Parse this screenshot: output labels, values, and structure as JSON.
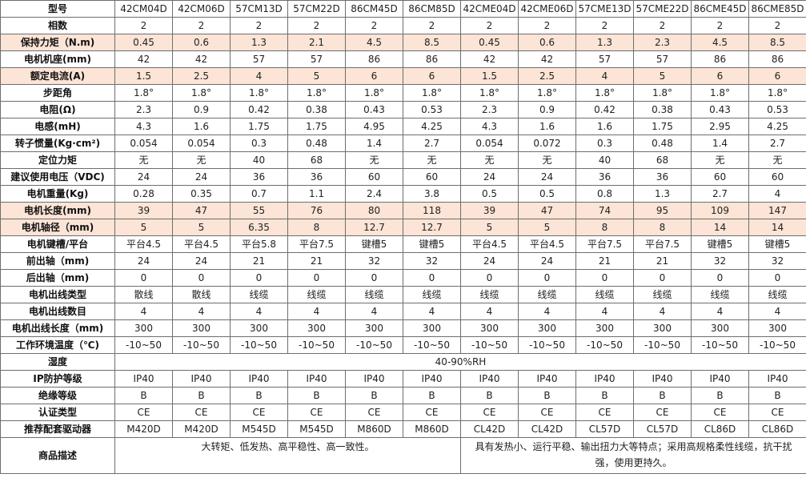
{
  "header": {
    "label": "型号",
    "models": [
      "42CM04D",
      "42CM06D",
      "57CM13D",
      "57CM22D",
      "86CM45D",
      "86CM85D",
      "42CME04D",
      "42CME06D",
      "57CME13D",
      "57CME22D",
      "86CME45D",
      "86CME85D"
    ]
  },
  "rows": [
    {
      "label": "相数",
      "highlight": false,
      "values": [
        "2",
        "2",
        "2",
        "2",
        "2",
        "2",
        "2",
        "2",
        "2",
        "2",
        "2",
        "2"
      ]
    },
    {
      "label": "保持力矩（N.m)",
      "highlight": true,
      "values": [
        "0.45",
        "0.6",
        "1.3",
        "2.1",
        "4.5",
        "8.5",
        "0.45",
        "0.6",
        "1.3",
        "2.3",
        "4.5",
        "8.5"
      ]
    },
    {
      "label": "电机机座(mm)",
      "highlight": false,
      "values": [
        "42",
        "42",
        "57",
        "57",
        "86",
        "86",
        "42",
        "42",
        "57",
        "57",
        "86",
        "86"
      ]
    },
    {
      "label": "额定电流(A)",
      "highlight": true,
      "values": [
        "1.5",
        "2.5",
        "4",
        "5",
        "6",
        "6",
        "1.5",
        "2.5",
        "4",
        "5",
        "6",
        "6"
      ]
    },
    {
      "label": "步距角",
      "highlight": false,
      "values": [
        "1.8°",
        "1.8°",
        "1.8°",
        "1.8°",
        "1.8°",
        "1.8°",
        "1.8°",
        "1.8°",
        "1.8°",
        "1.8°",
        "1.8°",
        "1.8°"
      ]
    },
    {
      "label": "电阻(Ω)",
      "highlight": false,
      "values": [
        "2.3",
        "0.9",
        "0.42",
        "0.38",
        "0.43",
        "0.53",
        "2.3",
        "0.9",
        "0.42",
        "0.38",
        "0.43",
        "0.53"
      ]
    },
    {
      "label": "电感(mH)",
      "highlight": false,
      "values": [
        "4.3",
        "1.6",
        "1.75",
        "1.75",
        "4.95",
        "4.25",
        "4.3",
        "1.6",
        "1.6",
        "1.75",
        "2.95",
        "4.25"
      ]
    },
    {
      "label": "转子惯量(Kg·cm²)",
      "highlight": false,
      "values": [
        "0.054",
        "0.054",
        "0.3",
        "0.48",
        "1.4",
        "2.7",
        "0.054",
        "0.072",
        "0.3",
        "0.48",
        "1.4",
        "2.7"
      ]
    },
    {
      "label": "定位力矩",
      "highlight": false,
      "values": [
        "无",
        "无",
        "40",
        "68",
        "无",
        "无",
        "无",
        "无",
        "40",
        "68",
        "无",
        "无"
      ]
    },
    {
      "label": "建议使用电压（VDC)",
      "highlight": false,
      "values": [
        "24",
        "24",
        "36",
        "36",
        "60",
        "60",
        "24",
        "24",
        "36",
        "36",
        "60",
        "60"
      ]
    },
    {
      "label": "电机重量(Kg)",
      "highlight": false,
      "values": [
        "0.28",
        "0.35",
        "0.7",
        "1.1",
        "2.4",
        "3.8",
        "0.5",
        "0.5",
        "0.8",
        "1.3",
        "2.7",
        "4"
      ]
    },
    {
      "label": "电机长度(mm)",
      "highlight": true,
      "values": [
        "39",
        "47",
        "55",
        "76",
        "80",
        "118",
        "39",
        "47",
        "74",
        "95",
        "109",
        "147"
      ]
    },
    {
      "label": "电机轴径（mm)",
      "highlight": true,
      "values": [
        "5",
        "5",
        "6.35",
        "8",
        "12.7",
        "12.7",
        "5",
        "5",
        "8",
        "8",
        "14",
        "14"
      ]
    },
    {
      "label": "电机键槽/平台",
      "highlight": false,
      "values": [
        "平台4.5",
        "平台4.5",
        "平台5.8",
        "平台7.5",
        "键槽5",
        "键槽5",
        "平台4.5",
        "平台4.5",
        "平台7.5",
        "平台7.5",
        "键槽5",
        "键槽5"
      ]
    },
    {
      "label": "前出轴（mm)",
      "highlight": false,
      "values": [
        "24",
        "24",
        "21",
        "21",
        "32",
        "32",
        "24",
        "24",
        "21",
        "21",
        "32",
        "32"
      ]
    },
    {
      "label": "后出轴（mm)",
      "highlight": false,
      "values": [
        "0",
        "0",
        "0",
        "0",
        "0",
        "0",
        "0",
        "0",
        "0",
        "0",
        "0",
        "0"
      ]
    },
    {
      "label": "电机出线类型",
      "highlight": false,
      "values": [
        "散线",
        "散线",
        "线缆",
        "线缆",
        "线缆",
        "线缆",
        "线缆",
        "线缆",
        "线缆",
        "线缆",
        "线缆",
        "线缆"
      ]
    },
    {
      "label": "电机出线数目",
      "highlight": false,
      "values": [
        "4",
        "4",
        "4",
        "4",
        "4",
        "4",
        "4",
        "4",
        "4",
        "4",
        "4",
        "4"
      ]
    },
    {
      "label": "电机出线长度（mm)",
      "highlight": false,
      "values": [
        "300",
        "300",
        "300",
        "300",
        "300",
        "300",
        "300",
        "300",
        "300",
        "300",
        "300",
        "300"
      ]
    },
    {
      "label": "工作环境温度（℃)",
      "highlight": false,
      "values": [
        "-10~50",
        "-10~50",
        "-10~50",
        "-10~50",
        "-10~50",
        "-10~50",
        "-10~50",
        "-10~50",
        "-10~50",
        "-10~50",
        "-10~50",
        "-10~50"
      ]
    }
  ],
  "humidity": {
    "label": "湿度",
    "value": "40-90%RH"
  },
  "rows2": [
    {
      "label": "IP防护等级",
      "highlight": false,
      "values": [
        "IP40",
        "IP40",
        "IP40",
        "IP40",
        "IP40",
        "IP40",
        "IP40",
        "IP40",
        "IP40",
        "IP40",
        "IP40",
        "IP40"
      ]
    },
    {
      "label": "绝缘等级",
      "highlight": false,
      "values": [
        "B",
        "B",
        "B",
        "B",
        "B",
        "B",
        "B",
        "B",
        "B",
        "B",
        "B",
        "B"
      ]
    },
    {
      "label": "认证类型",
      "highlight": false,
      "values": [
        "CE",
        "CE",
        "CE",
        "CE",
        "CE",
        "CE",
        "CE",
        "CE",
        "CE",
        "CE",
        "CE",
        "CE"
      ]
    },
    {
      "label": "推荐配套驱动器",
      "highlight": false,
      "values": [
        "M420D",
        "M420D",
        "M545D",
        "M545D",
        "M860D",
        "M860D",
        "CL42D",
        "CL42D",
        "CL57D",
        "CL57D",
        "CL86D",
        "CL86D"
      ]
    }
  ],
  "description": {
    "label": "商品描述",
    "left": "大转矩、低发热、高平稳性、高一致性。",
    "right": "具有发热小、运行平稳、输出扭力大等特点；采用高规格柔性线缆，抗干扰强，使用更持久。"
  }
}
